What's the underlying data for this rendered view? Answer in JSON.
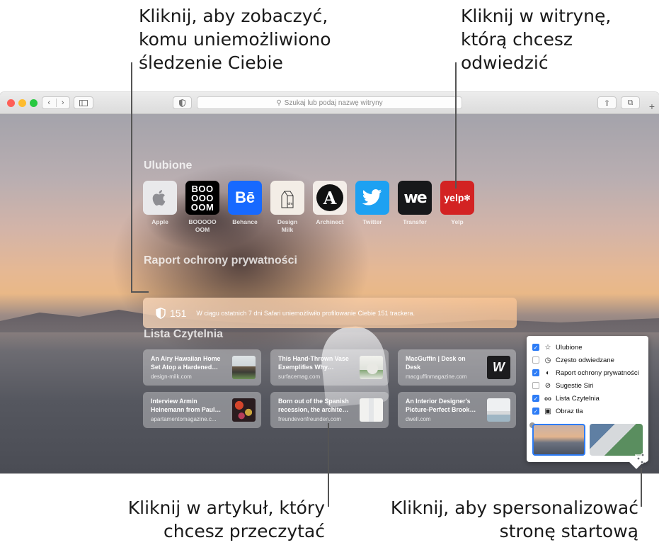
{
  "callouts": {
    "tracking": "Kliknij, aby zobaczyć,\nkomu uniemożliwiono\nśledzenie Ciebie",
    "site": "Kliknij w witrynę,\nktórą chcesz\nodwiedzić",
    "article": "Kliknij w artykuł, który\nchcesz przeczytać",
    "customize": "Kliknij, aby spersonalizować\nstronę startową"
  },
  "toolbar": {
    "search_placeholder": "Szukaj lub podaj nazwę witryny",
    "new_tab": "+"
  },
  "favorites": {
    "title": "Ulubione",
    "items": [
      {
        "label": "Apple",
        "icon": "apple-icon"
      },
      {
        "label": "BOOOOO\nOOM",
        "icon": "boooooom-icon",
        "glyph": "BOO\nOOO\nOOM"
      },
      {
        "label": "Behance",
        "icon": "behance-icon",
        "glyph": "Bē"
      },
      {
        "label": "Design\nMilk",
        "icon": "design-milk-icon",
        "glyph": "dm"
      },
      {
        "label": "Archinect",
        "icon": "archinect-icon",
        "glyph": "A"
      },
      {
        "label": "Twitter",
        "icon": "twitter-icon"
      },
      {
        "label": "Transfer",
        "icon": "transfer-icon",
        "glyph": "we"
      },
      {
        "label": "Yelp",
        "icon": "yelp-icon",
        "glyph": "yelp"
      }
    ]
  },
  "privacy": {
    "title": "Raport ochrony prywatności",
    "count": "151",
    "message": "W ciągu ostatnich 7 dni Safari uniemożliwiło profilowanie Ciebie 151 trackera."
  },
  "reading_list": {
    "title": "Lista Czytelnia",
    "items": [
      {
        "title": "An Airy Hawaiian Home Set Atop a Hardened…",
        "source": "design-milk.com"
      },
      {
        "title": "This Hand-Thrown Vase Exemplifies Why…",
        "source": "surfacemag.com"
      },
      {
        "title": "MacGuffin | Desk on Desk",
        "source": "macguffinmagazine.com",
        "glyph": "W"
      },
      {
        "title": "Interview Armin Heinemann from Paul…",
        "source": "apartamentomagazine.c..."
      },
      {
        "title": "Born out of the Spanish recession, the archite…",
        "source": "freundevonfreunden.com"
      },
      {
        "title": "An Interior Designer's Picture-Perfect Brook…",
        "source": "dwell.com"
      }
    ]
  },
  "customize_panel": {
    "options": [
      {
        "label": "Ulubione",
        "checked": true,
        "icon": "star-icon",
        "glyph": "☆"
      },
      {
        "label": "Często odwiedzane",
        "checked": false,
        "icon": "clock-icon",
        "glyph": "◷"
      },
      {
        "label": "Raport ochrony prywatności",
        "checked": true,
        "icon": "shield-icon",
        "glyph": "◐"
      },
      {
        "label": "Sugestie Siri",
        "checked": false,
        "icon": "compass-icon",
        "glyph": "⊘"
      },
      {
        "label": "Lista Czytelnia",
        "checked": true,
        "icon": "glasses-icon",
        "glyph": "oo"
      },
      {
        "label": "Obraz tła",
        "checked": true,
        "icon": "image-icon",
        "glyph": "▣"
      }
    ],
    "check_glyph": "✓"
  },
  "colors": {
    "accent": "#2d7cf6",
    "behance": "#1769ff",
    "twitter": "#1da1f2",
    "yelp": "#d32323"
  }
}
